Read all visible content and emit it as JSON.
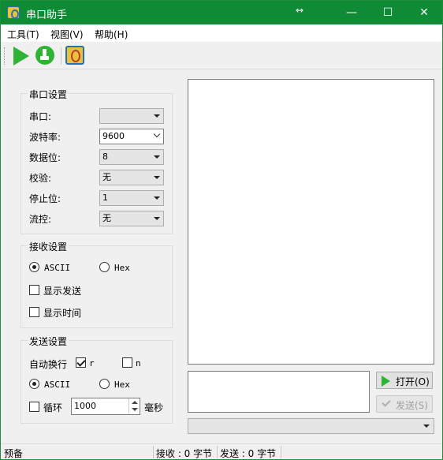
{
  "window": {
    "title": "串口助手",
    "resize_glyph": "↔",
    "minimize": "—",
    "maximize": "☐",
    "close": "✕"
  },
  "menu": [
    {
      "label": "工具(T)"
    },
    {
      "label": "视图(V)"
    },
    {
      "label": "帮助(H)"
    }
  ],
  "toolbar": {
    "icons": [
      "play-icon",
      "broom-icon",
      "about-icon"
    ]
  },
  "serial_settings": {
    "title": "串口设置",
    "port_label": "串口:",
    "port_value": "",
    "baud_label": "波特率:",
    "baud_value": "9600",
    "databits_label": "数据位:",
    "databits_value": "8",
    "parity_label": "校验:",
    "parity_value": "无",
    "stopbits_label": "停止位:",
    "stopbits_value": "1",
    "flow_label": "流控:",
    "flow_value": "无"
  },
  "receive_settings": {
    "title": "接收设置",
    "ascii_label": "ASCII",
    "hex_label": "Hex",
    "show_send_label": "显示发送",
    "show_time_label": "显示时间"
  },
  "send_settings": {
    "title": "发送设置",
    "auto_newline_label": "自动换行",
    "r_label": "r",
    "n_label": "n",
    "ascii_label": "ASCII",
    "hex_label": "Hex",
    "loop_label": "循环",
    "interval_value": "1000",
    "interval_unit": "毫秒"
  },
  "buttons": {
    "open_label": "打开(O)",
    "send_label": "发送(S)"
  },
  "statusbar": {
    "ready": "预备",
    "received": "接收 : 0 字节",
    "sent": "发送 : 0 字节"
  },
  "colors": {
    "titlebar": "#0f8a35",
    "accent_green": "#2fb335"
  }
}
